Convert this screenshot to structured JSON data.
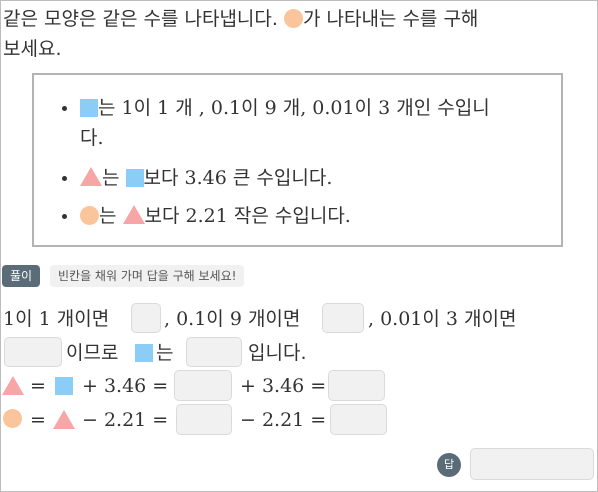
{
  "question": {
    "line1_before": "같은 모양은 같은 수를 나타냅니다. ",
    "line1_after": "가 나타내는 수를 구해",
    "line2": "보세요."
  },
  "conditions": {
    "c1_line1": "는 1이 1 개 , 0.1이 9 개, 0.01이 3 개인 수입니",
    "c1_line2": "다.",
    "c2_mid": "는 ",
    "c2_end": "보다 3.46 큰 수입니다.",
    "c3_mid": "는 ",
    "c3_end": "보다 2.21 작은 수입니다."
  },
  "solution": {
    "badge": "풀이",
    "hint": "빈칸을 채워 가며 답을 구해 보세요!",
    "l1_a": "1이 1 개이면",
    "l1_b": ", 0.1이 9 개이면",
    "l1_c": ", 0.01이 3 개이면",
    "l2_a": "이므로",
    "l2_b": "는",
    "l2_c": "입니다.",
    "l3_eq1": "=",
    "l3_plus": "+ 3.46 =",
    "l3_plus2": "+ 3.46 =",
    "l4_eq1": "=",
    "l4_minus": "− 2.21 =",
    "l4_minus2": "− 2.21 ="
  },
  "answer": {
    "badge": "답"
  },
  "colors": {
    "circle": "#fbc59b",
    "square": "#8bcdf7",
    "triangle": "#f6a6a6",
    "badge": "#596c78"
  }
}
